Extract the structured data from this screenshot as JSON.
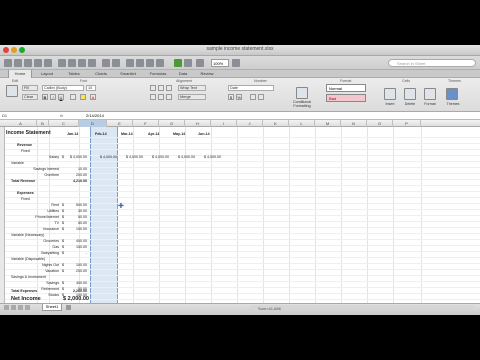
{
  "app": {
    "doc_title": "sample income statement.xlsx",
    "zoom": "100%",
    "search_placeholder": "Search in Sheet"
  },
  "ribbon": {
    "tabs": [
      "Home",
      "Layout",
      "Tables",
      "Charts",
      "SmartArt",
      "Formulas",
      "Data",
      "Review"
    ],
    "groups": [
      "Edit",
      "Font",
      "Alignment",
      "Number",
      "Format",
      "Cells",
      "Themes"
    ],
    "font_name": "Calibri (Body)",
    "font_size": "10",
    "fill_label": "Fill",
    "clear_label": "Clear",
    "wrap_text": "Wrap Text",
    "number_format": "Date",
    "merge_label": "Merge",
    "style_normal": "Normal",
    "style_bad": "Bad",
    "cond_format": "Conditional Formatting",
    "cell_buttons": [
      "Insert",
      "Delete",
      "Format",
      "Themes"
    ]
  },
  "formula_bar": {
    "name_box": "D1",
    "fx": "fx",
    "value": "2/14/2014"
  },
  "columns": [
    "A",
    "B",
    "C",
    "D",
    "E",
    "F",
    "G",
    "H",
    "I",
    "J",
    "K",
    "L",
    "M",
    "N",
    "O",
    "P"
  ],
  "sheet": {
    "title": "Income Statement",
    "months": [
      "Jan-14",
      "Feb-14",
      "Mar-14",
      "Apr-14",
      "May-14",
      "Jun-14"
    ],
    "revenue": "Revenue",
    "fixed": "Fixed",
    "salary_label": "Salary",
    "salary_values": [
      "$ 4,000.00",
      "$ 4,000.00",
      "$ 4,000.00",
      "$ 4,000.00",
      "$ 4,000.00",
      "$ 4,000.00"
    ],
    "variable": "Variable",
    "savings_interest": "Savings Interest",
    "savings_interest_val": "10.00",
    "overtime": "Overtime",
    "overtime_val": "200.00",
    "total_revenue": "Total Revenue",
    "total_revenue_val": "4,210.00",
    "expenses": "Expenses",
    "expense_items": [
      {
        "label": "Rent",
        "value": "500.00"
      },
      {
        "label": "Utilities",
        "value": "30.00"
      },
      {
        "label": "Phone/Internet",
        "value": "50.00"
      },
      {
        "label": "TV",
        "value": "50.00"
      },
      {
        "label": "Insurance",
        "value": "100.00"
      }
    ],
    "variable_necessary": "Variable (Necessary)",
    "necessary_items": [
      {
        "label": "Groceries",
        "value": "400.00"
      },
      {
        "label": "Gas",
        "value": "150.00"
      },
      {
        "label": "Babysitting",
        "value": "-"
      }
    ],
    "variable_disposable": "Variable (Disposable)",
    "disposable_items": [
      {
        "label": "Nights Out",
        "value": "100.00"
      },
      {
        "label": "Vacation",
        "value": "200.00"
      }
    ],
    "savings_investment": "Savings & Investment",
    "saving_items": [
      {
        "label": "Savings",
        "value": "400.00"
      },
      {
        "label": "Retirement",
        "value": "50.00"
      },
      {
        "label": "Stocks",
        "value": "100.00"
      }
    ],
    "total_expenses": "Total Expenses",
    "total_expenses_val": "2,260.00",
    "net_income": "Net Income",
    "net_income_val": "$ 2,000.00",
    "currency": "$"
  },
  "statusbar": {
    "sheet_tab": "Sheet1",
    "status": "Sum=41,686"
  }
}
